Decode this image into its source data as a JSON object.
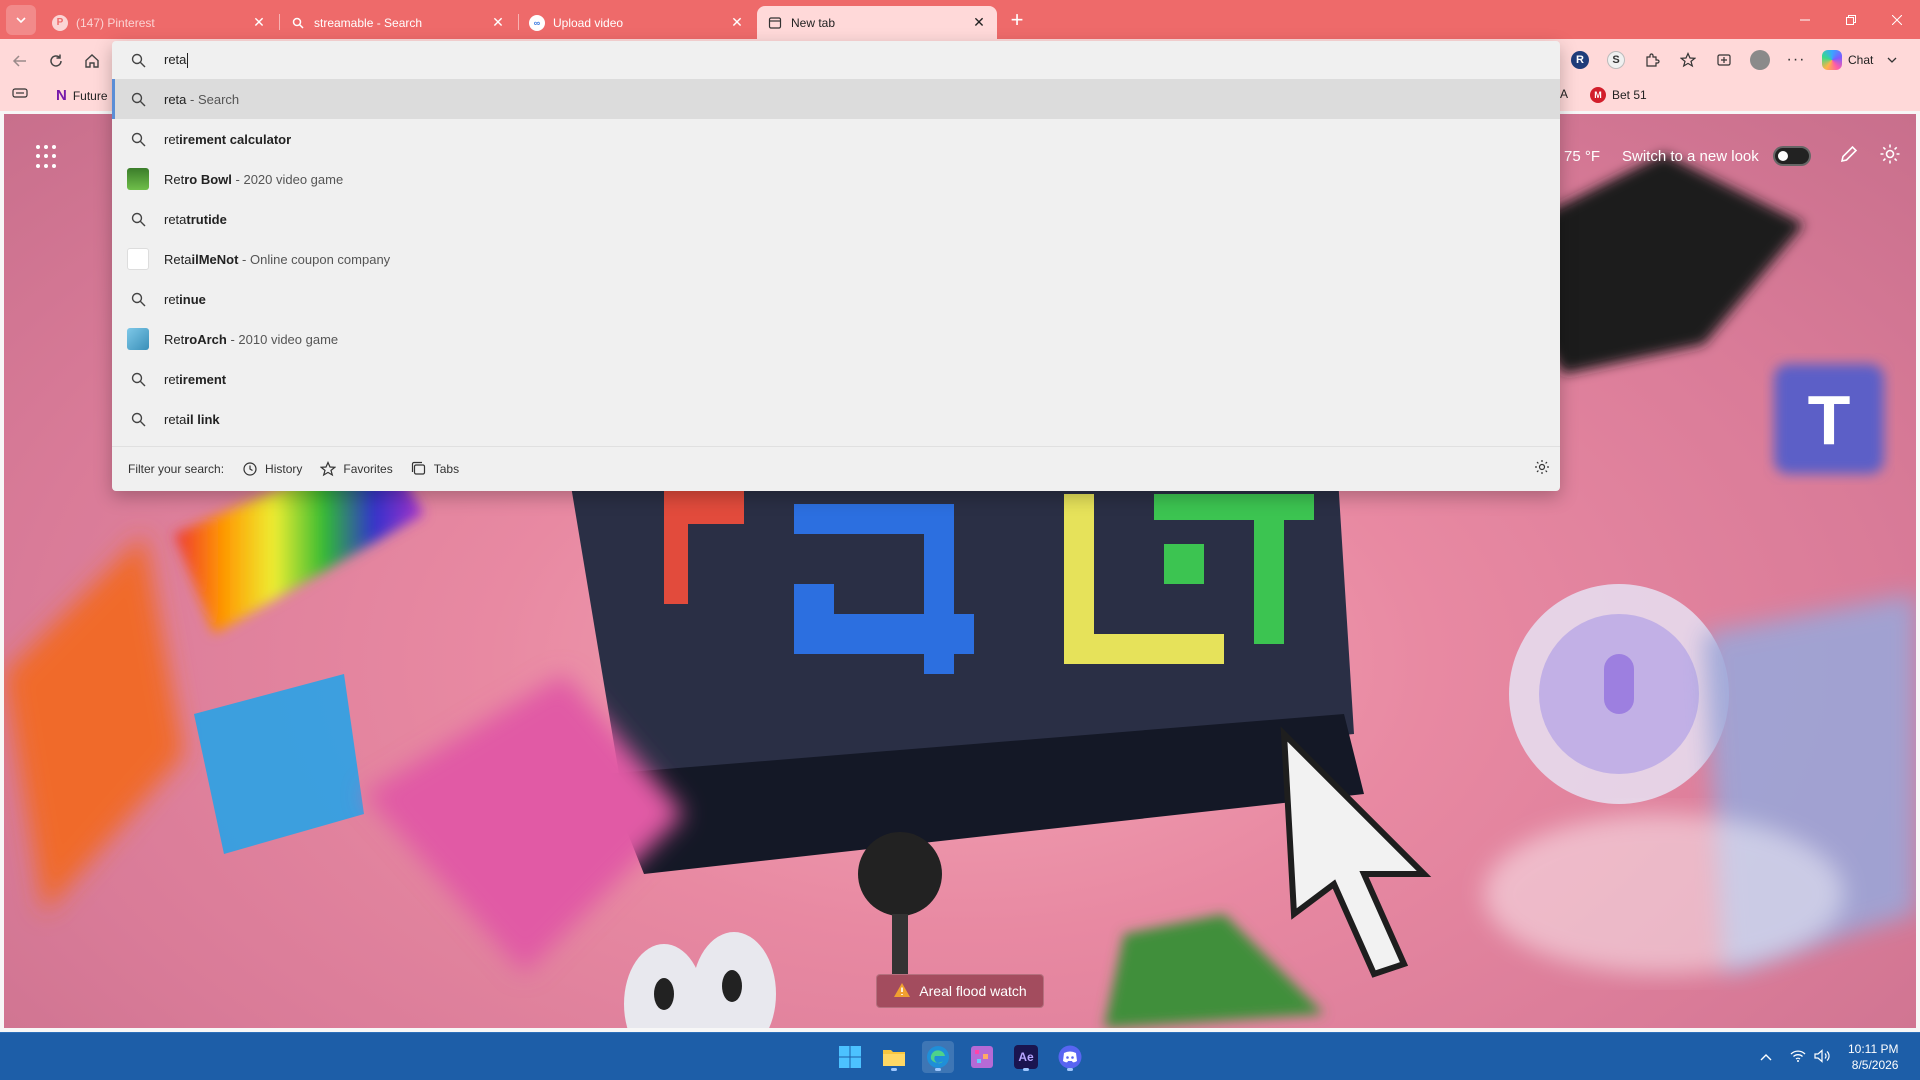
{
  "tabs": [
    {
      "title": "(147) Pinterest",
      "icon": "pinterest-icon",
      "state": "dim"
    },
    {
      "title": "streamable - Search",
      "icon": "search-icon",
      "state": "normal"
    },
    {
      "title": "Upload video",
      "icon": "streamable-icon",
      "state": "normal"
    },
    {
      "title": "New tab",
      "icon": "newtab-icon",
      "state": "active"
    }
  ],
  "toolbar": {
    "chat_label": "Chat"
  },
  "favorites": [
    {
      "label": "Future",
      "icon": "N"
    },
    {
      "label": "A",
      "icon": ""
    },
    {
      "label": "Bet 51",
      "icon": "M"
    }
  ],
  "omnibox": {
    "query": "reta",
    "suggestions": [
      {
        "bold": "",
        "prefix": "reta",
        "suffix": "",
        "sub": " - Search",
        "icon": "search"
      },
      {
        "prefix": "ret",
        "bold": "irement calculator",
        "sub": "",
        "icon": "search"
      },
      {
        "prefix": "Ret",
        "bold": "ro Bowl",
        "sub": " - 2020 video game",
        "icon": "retrobowl-thumb"
      },
      {
        "prefix": "reta",
        "bold": "trutide",
        "sub": "",
        "icon": "search"
      },
      {
        "prefix": "Reta",
        "bold": "ilMeNot",
        "sub": " - Online coupon company",
        "icon": "retailmenot-thumb"
      },
      {
        "prefix": "ret",
        "bold": "inue",
        "sub": "",
        "icon": "search"
      },
      {
        "prefix": "Ret",
        "bold": "roArch",
        "sub": " - 2010 video game",
        "icon": "retroarch-thumb"
      },
      {
        "prefix": "ret",
        "bold": "irement",
        "sub": "",
        "icon": "search"
      },
      {
        "prefix": "reta",
        "bold": "il link",
        "sub": "",
        "icon": "search"
      }
    ],
    "filter_label": "Filter your search:",
    "filters": [
      "History",
      "Favorites",
      "Tabs"
    ]
  },
  "ntp": {
    "temperature": "75 °F",
    "new_look_label": "Switch to a new look",
    "alert": "Areal flood watch"
  },
  "taskbar": {
    "time": "10:11 PM",
    "date": "8/5/2026"
  },
  "colors": {
    "tabstrip": "#ee6a6a",
    "toolbar": "#ffd9d9",
    "taskbar": "#1d5ea8"
  }
}
